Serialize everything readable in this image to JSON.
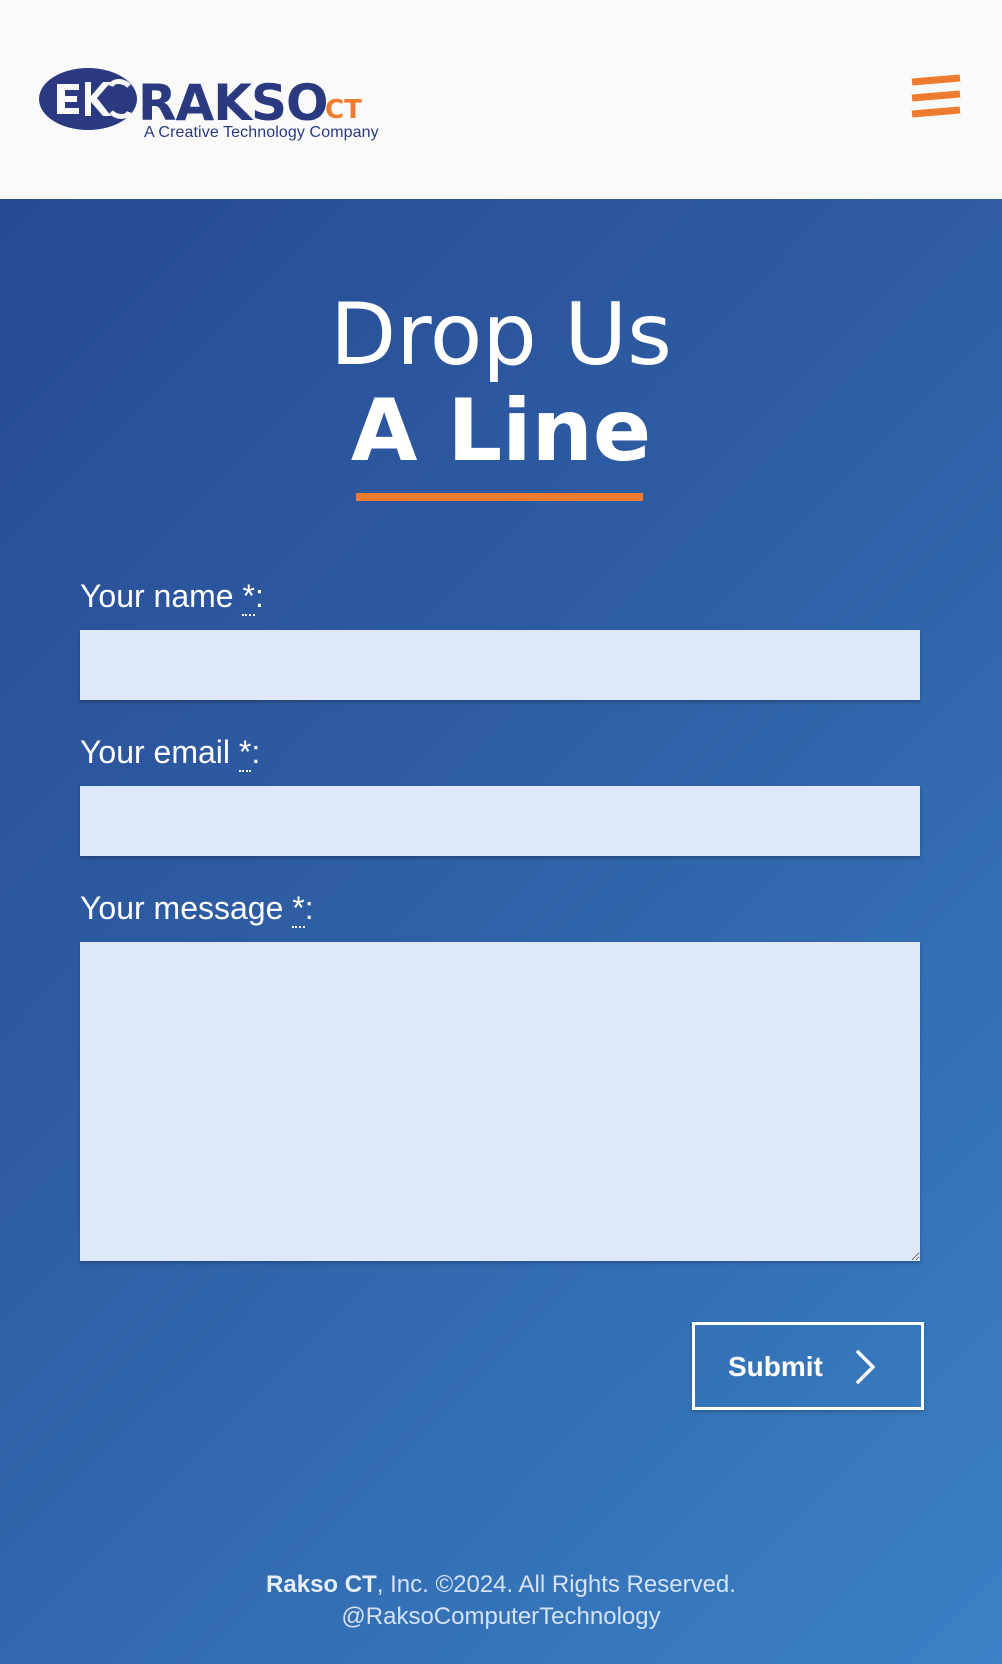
{
  "header": {
    "logo": {
      "wordmark": "RAKSO",
      "suffix": "CT",
      "tagline": "A Creative Technology Company"
    },
    "menu_icon": "hamburger-icon"
  },
  "contact": {
    "title_line1": "Drop Us",
    "title_line2": "A Line",
    "fields": [
      {
        "label": "Your name ",
        "required_mark": "*",
        "suffix": ":",
        "value": "",
        "type": "text"
      },
      {
        "label": "Your email ",
        "required_mark": "*",
        "suffix": ":",
        "value": "",
        "type": "email"
      },
      {
        "label": "Your message ",
        "required_mark": "*",
        "suffix": ":",
        "value": "",
        "type": "textarea"
      }
    ],
    "submit_label": "Submit",
    "submit_icon": "chevron-right-icon"
  },
  "footer": {
    "company": "Rakso CT",
    "rights": ", Inc. ©2024. All Rights Reserved.",
    "handle": "@RaksoComputerTechnology"
  },
  "colors": {
    "brand_navy": "#2b3a80",
    "accent_orange": "#ee7b30",
    "background_start": "#284a94",
    "background_end": "#3a81c6",
    "input_background": "#dfe8f8",
    "header_background": "#fafafa"
  }
}
